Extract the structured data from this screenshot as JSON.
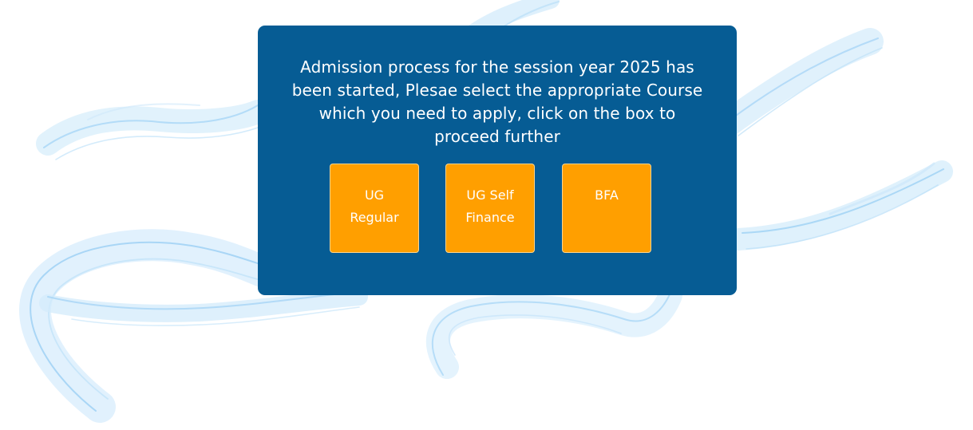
{
  "notice": {
    "message": "Admission process for the session year 2025 has been started, Plesae select the appropriate Course which you need to apply, click on the box to proceed further"
  },
  "courses": [
    {
      "label": "UG Regular"
    },
    {
      "label": "UG Self Finance"
    },
    {
      "label": "BFA"
    }
  ],
  "colors": {
    "panel": "#065c94",
    "course_box": "#ff9f00",
    "text": "#ffffff",
    "waves": "#8fcaf1"
  }
}
